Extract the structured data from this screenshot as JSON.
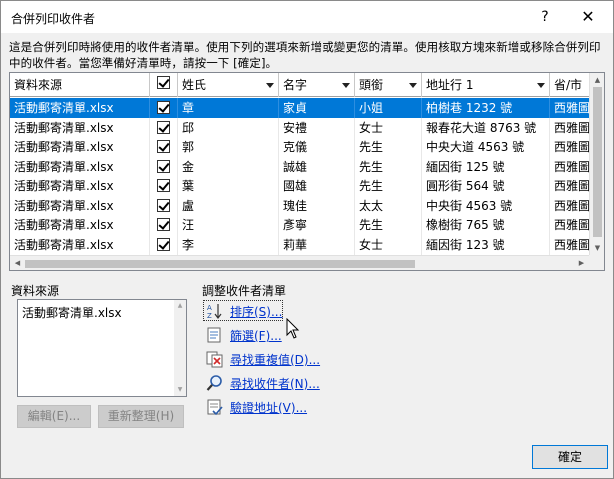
{
  "window": {
    "title": "合併列印收件者",
    "help_label": "?",
    "close_label": "✕"
  },
  "description": "這是合併列印時將使用的收件者清單。使用下列的選項來新增或變更您的清單。使用核取方塊來新增或移除合併列印中的收件者。當您準備好清單時，請按一下 [確定]。",
  "grid": {
    "columns": [
      "資料來源",
      "",
      "姓氏",
      "名字",
      "頭銜",
      "地址行 1",
      "省/市"
    ],
    "rows": [
      {
        "source": "活動郵寄清單.xlsx",
        "checked": true,
        "last": "章",
        "first": "家貞",
        "title": "小姐",
        "address": "柏樹巷 1232 號",
        "city": "西雅圖",
        "selected": true
      },
      {
        "source": "活動郵寄清單.xlsx",
        "checked": true,
        "last": "邱",
        "first": "安禮",
        "title": "女士",
        "address": "報春花大道 8763 號",
        "city": "西雅圖",
        "selected": false
      },
      {
        "source": "活動郵寄清單.xlsx",
        "checked": true,
        "last": "郭",
        "first": "克儀",
        "title": "先生",
        "address": "中央大道 4563 號",
        "city": "西雅圖",
        "selected": false
      },
      {
        "source": "活動郵寄清單.xlsx",
        "checked": true,
        "last": "金",
        "first": "誠雄",
        "title": "先生",
        "address": "緬因街 125 號",
        "city": "西雅圖",
        "selected": false
      },
      {
        "source": "活動郵寄清單.xlsx",
        "checked": true,
        "last": "葉",
        "first": "國雄",
        "title": "先生",
        "address": "圓形街 564 號",
        "city": "西雅圖",
        "selected": false
      },
      {
        "source": "活動郵寄清單.xlsx",
        "checked": true,
        "last": "盧",
        "first": "瑰佳",
        "title": "太太",
        "address": "中央街 4563 號",
        "city": "西雅圖",
        "selected": false
      },
      {
        "source": "活動郵寄清單.xlsx",
        "checked": true,
        "last": "汪",
        "first": "彥寧",
        "title": "先生",
        "address": "橡樹街 765 號",
        "city": "西雅圖",
        "selected": false
      },
      {
        "source": "活動郵寄清單.xlsx",
        "checked": true,
        "last": "李",
        "first": "莉華",
        "title": "女士",
        "address": "緬因街 123 號",
        "city": "西雅圖",
        "selected": false
      }
    ]
  },
  "data_source": {
    "label": "資料來源",
    "items": [
      "活動郵寄清單.xlsx"
    ],
    "edit_button": "編輯(E)...",
    "refresh_button": "重新整理(H)"
  },
  "refine": {
    "label": "調整收件者清單",
    "sort": "排序(S)...",
    "filter": "篩選(F)...",
    "find_duplicates": "尋找重複值(D)...",
    "find_recipient": "尋找收件者(N)...",
    "validate": "驗證地址(V)..."
  },
  "ok_button": "確定",
  "colors": {
    "selection": "#0078d7",
    "link": "#0033cc"
  }
}
